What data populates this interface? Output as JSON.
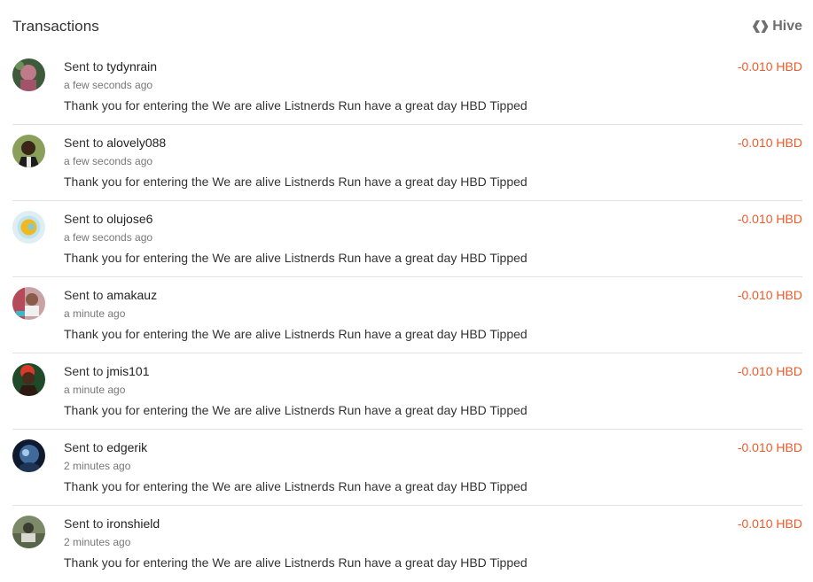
{
  "header": {
    "title": "Transactions",
    "brand": "Hive",
    "brand_icon": "hive-logo-icon"
  },
  "colors": {
    "amount": "#ee5a2a",
    "text": "#333333",
    "muted": "#777777",
    "divider": "#e3e3e3"
  },
  "transactions": [
    {
      "prefix": "Sent to",
      "user": "tydynrain",
      "time": "a few seconds ago",
      "memo": "Thank you for entering the We are alive Listnerds Run have a great day HBD Tipped",
      "amount": "-0.010 HBD",
      "avatar": "avatar-tydynrain"
    },
    {
      "prefix": "Sent to",
      "user": "alovely088",
      "time": "a few seconds ago",
      "memo": "Thank you for entering the We are alive Listnerds Run have a great day HBD Tipped",
      "amount": "-0.010 HBD",
      "avatar": "avatar-alovely088"
    },
    {
      "prefix": "Sent to",
      "user": "olujose6",
      "time": "a few seconds ago",
      "memo": "Thank you for entering the We are alive Listnerds Run have a great day HBD Tipped",
      "amount": "-0.010 HBD",
      "avatar": "avatar-olujose6"
    },
    {
      "prefix": "Sent to",
      "user": "amakauz",
      "time": "a minute ago",
      "memo": "Thank you for entering the We are alive Listnerds Run have a great day HBD Tipped",
      "amount": "-0.010 HBD",
      "avatar": "avatar-amakauz"
    },
    {
      "prefix": "Sent to",
      "user": "jmis101",
      "time": "a minute ago",
      "memo": "Thank you for entering the We are alive Listnerds Run have a great day HBD Tipped",
      "amount": "-0.010 HBD",
      "avatar": "avatar-jmis101"
    },
    {
      "prefix": "Sent to",
      "user": "edgerik",
      "time": "2 minutes ago",
      "memo": "Thank you for entering the We are alive Listnerds Run have a great day HBD Tipped",
      "amount": "-0.010 HBD",
      "avatar": "avatar-edgerik"
    },
    {
      "prefix": "Sent to",
      "user": "ironshield",
      "time": "2 minutes ago",
      "memo": "Thank you for entering the We are alive Listnerds Run have a great day HBD Tipped",
      "amount": "-0.010 HBD",
      "avatar": "avatar-ironshield"
    }
  ]
}
